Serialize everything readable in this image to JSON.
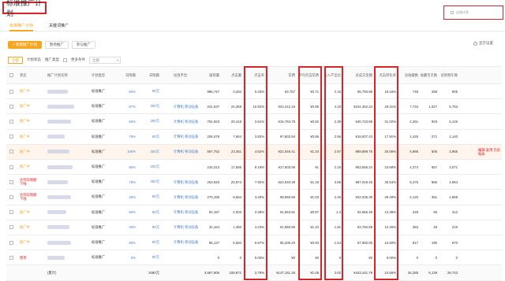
{
  "header": {
    "title": "标准推广计划",
    "shop_selector": "店铺计划"
  },
  "tabs": [
    {
      "label": "标准推广计划",
      "active": true
    },
    {
      "label": "关键词推广",
      "active": false
    }
  ],
  "toolbar": {
    "new_plan": "+ 新建推广计划",
    "pause": "暂停推广",
    "resume": "参与推广",
    "settings": "显示设置"
  },
  "filters": {
    "all": "全部",
    "status_label": "计划状态",
    "plan_type": "推广类型",
    "more": "更多条件",
    "select_value": "全部"
  },
  "columns": [
    "状态",
    "推广计划名称",
    "计划类型",
    "日限额",
    "日限额",
    "投放平台",
    "展现量",
    "点击量",
    "点击率",
    "花费",
    "平均点击花费",
    "投入产出比",
    "总成交金额",
    "总成交笔数",
    "点击转化率",
    "总收藏数",
    "收藏宝贝数",
    "总购物车数"
  ],
  "rows": [
    {
      "status": "推广中",
      "status_type": "on",
      "type": "标准推广",
      "pct": "60%",
      "budget": "80元",
      "platform": "",
      "impr": "996,747",
      "clicks": "3,284",
      "ctr": "0.33%",
      "cost": "¥3,767",
      "cpc": "¥0.71",
      "roi": "2.15",
      "gmv": "¥5,793.98",
      "orders": "",
      "cvr": "19.16%",
      "fav": "748",
      "fav_item": "289",
      "cart": "805",
      "alt": false,
      "ops": ""
    },
    {
      "status": "推广中",
      "status_type": "on",
      "type": "标准推广",
      "pct": "67%",
      "budget": "250元",
      "platform": "计算机 移动设备",
      "impr": "241,537",
      "clicks": "24,369",
      "ctr": "10.92%",
      "cost": "¥23,412.15",
      "cpc": "¥0.96",
      "roi": "4.19",
      "gmv": "¥104,252.24",
      "orders": "",
      "cvr": "29.31%",
      "fav": "7,734",
      "fav_item": "1,027",
      "cart": "6,753",
      "alt": false,
      "ops": ""
    },
    {
      "status": "推广中",
      "status_type": "on",
      "type": "标准推广",
      "pct": "55%",
      "budget": "250元",
      "platform": "计算机 移动设备",
      "impr": "791,923",
      "clicks": "20,418",
      "ctr": "2.61%",
      "cost": "¥16,763.78",
      "cpc": "¥0.82",
      "roi": "2.39",
      "gmv": "¥40,743.89",
      "orders": "",
      "cvr": "21.02%",
      "fav": "4,261",
      "fav_item": "903",
      "cart": "5,126",
      "alt": false,
      "ops": ""
    },
    {
      "status": "推广中",
      "status_type": "on",
      "type": "标准推广",
      "pct": "75%",
      "budget": "80元",
      "platform": "计算机 移动设备",
      "impr": "208,479",
      "clicks": "7,964",
      "ctr": "3.82%",
      "cost": "¥7,802.94",
      "cpc": "¥0.95",
      "roi": "2.56",
      "gmv": "¥19,937.43",
      "orders": "",
      "cvr": "17.91%",
      "fav": "1,426",
      "fav_item": "271",
      "cart": "1,140",
      "alt": false,
      "ops": ""
    },
    {
      "status": "推广中",
      "status_type": "on",
      "type": "标准推广",
      "pct": "100%",
      "budget": "300元",
      "platform": "计算机 移动设备",
      "impr": "567,752",
      "clicks": "23,451",
      "ctr": "4.62%",
      "cost": "¥31,546.41",
      "cpc": "¥1.34",
      "roi": "2.87",
      "gmv": "¥89,899.75",
      "orders": "",
      "cvr": "25.56%",
      "fav": "5,995",
      "fav_item": "606",
      "cart": "3,965",
      "alt": true,
      "ops": "编辑 复用 历史报表"
    },
    {
      "status": "推广中",
      "status_type": "on",
      "type": "标准推广",
      "pct": "90%",
      "budget": "200元",
      "platform": "",
      "impr": "216,313",
      "clicks": "17,655",
      "ctr": "8.18%",
      "cost": "¥17,603.06",
      "cpc": "¥1",
      "roi": "2.16",
      "gmv": "¥53,556.24",
      "orders": "",
      "cvr": "24.68%",
      "fav": "4,374",
      "fav_item": "657",
      "cart": "3,071",
      "alt": false,
      "ops": ""
    },
    {
      "status": "达到日限额 下线",
      "status_type": "off",
      "type": "标准推广",
      "pct": "75%",
      "budget": "250元",
      "platform": "计算机 移动设备",
      "impr": "263,840",
      "clicks": "20,874",
      "ctr": "7.92%",
      "cost": "¥24,540.49",
      "cpc": "¥1.18",
      "roi": "3.55",
      "gmv": "¥87,019.45",
      "orders": "",
      "cvr": "30.54%",
      "fav": "5,375",
      "fav_item": "865",
      "cart": "4,984",
      "alt": false,
      "ops": ""
    },
    {
      "status": "达到日限额 下线",
      "status_type": "off",
      "type": "标准推广",
      "pct": "45%",
      "budget": "80元",
      "platform": "计算机 移动设备",
      "impr": "270,159",
      "clicks": "8,654",
      "ctr": "3.20%",
      "cost": "¥8,950.66",
      "cpc": "¥1.03",
      "roi": "2.46",
      "gmv": "¥22,035.39",
      "orders": "",
      "cvr": "29.49%",
      "fav": "2,120",
      "fav_item": "351",
      "cart": "1,969",
      "alt": false,
      "ops": ""
    },
    {
      "status": "推广中",
      "status_type": "on",
      "type": "标准推广",
      "pct": "60%",
      "budget": "80元",
      "platform": "计算机 移动设备",
      "impr": "84,157",
      "clicks": "2,003",
      "ctr": "2.38%",
      "cost": "¥1,953.91",
      "cpc": "¥0.97",
      "roi": "1.3",
      "gmv": "¥2,555.49",
      "orders": "",
      "cvr": "12.38%",
      "fav": "248",
      "fav_item": "66",
      "cart": "312",
      "alt": false,
      "ops": ""
    },
    {
      "status": "推广中",
      "status_type": "on",
      "type": "标准推广",
      "pct": "40%",
      "budget": "80元",
      "platform": "计算机 移动设备",
      "impr": "32,164",
      "clicks": "1,360",
      "ctr": "4.23%",
      "cost": "¥1,960.56",
      "cpc": "¥1.43",
      "roi": "1.91",
      "gmv": "¥3,760.88",
      "orders": "",
      "cvr": "12.26%",
      "fav": "383",
      "fav_item": "48",
      "cart": "216",
      "alt": false,
      "ops": ""
    },
    {
      "status": "推广中",
      "status_type": "on",
      "type": "标准推广",
      "pct": "50%",
      "budget": "80元",
      "platform": "计算机 移动设备",
      "impr": "85,127",
      "clicks": "5,594",
      "ctr": "6.57%",
      "cost": "¥5,200.20",
      "cpc": "¥0.93",
      "roi": "1.54",
      "gmv": "¥7,992.05",
      "orders": "",
      "cvr": "14.60%",
      "fav": "817",
      "fav_item": "190",
      "cart": "870",
      "alt": false,
      "ops": ""
    },
    {
      "status": "暂停",
      "status_type": "off",
      "type": "标准推广",
      "pct": "0%",
      "budget": "80元",
      "platform": "",
      "impr": "0",
      "clicks": "0",
      "ctr": "0.00%",
      "cost": "¥0",
      "cpc": "¥0",
      "roi": "0",
      "gmv": "¥0",
      "orders": "",
      "cvr": "0.00%",
      "fav": "0",
      "fav_item": "0",
      "cart": "0",
      "alt": false,
      "ops": ""
    }
  ],
  "totals": {
    "label": "(累计)",
    "budget": "2080元",
    "impr": "3,687,805",
    "clicks": "159,871",
    "ctr": "2.79%",
    "cost": "¥147,151.26",
    "cpc": "¥1.05",
    "roi": "3.02",
    "gmv": "¥443,441.79",
    "cvr": "24.55%",
    "fav": "34,285",
    "fav_item": "5,139",
    "cart": "29,743"
  }
}
